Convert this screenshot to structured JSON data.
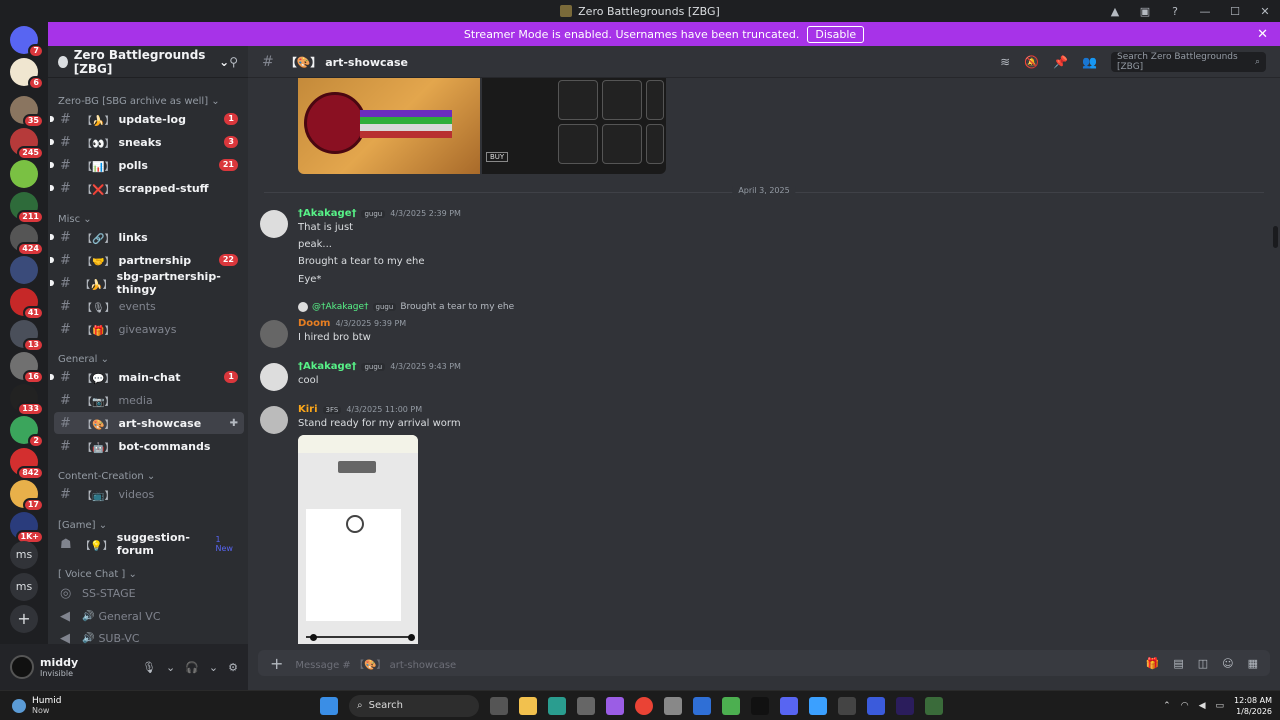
{
  "window": {
    "title": "Zero Battlegrounds [ZBG]",
    "controls": [
      "▲",
      "▣",
      "?",
      "—",
      "☐",
      "✕"
    ]
  },
  "banner": {
    "text": "Streamer Mode is enabled. Usernames have been truncated.",
    "button": "Disable",
    "close": "✕"
  },
  "rail": {
    "badges": [
      "7",
      "6",
      "35",
      "245",
      "211",
      "424",
      "41",
      "13",
      "16",
      "133",
      "2",
      "842",
      "17",
      "1K+"
    ],
    "text_items": [
      "ms",
      "ms"
    ],
    "add": "+"
  },
  "guild": {
    "name": "Zero Battlegrounds [ZBG]",
    "chevron": "⌄"
  },
  "categories": {
    "zero_bg": "Zero-BG [SBG archive as well] ⌄",
    "misc": "Misc ⌄",
    "general": "General ⌄",
    "content": "Content-Creation ⌄",
    "game": "[Game] ⌄",
    "voice": "[ Voice Chat ] ⌄"
  },
  "channels": [
    {
      "emoji": "【🍌】",
      "name": "update-log",
      "count": "1",
      "muted": false
    },
    {
      "emoji": "【👀】",
      "name": "sneaks",
      "count": "3",
      "muted": false
    },
    {
      "emoji": "【📊】",
      "name": "polls",
      "count": "21",
      "muted": false
    },
    {
      "emoji": "【❌】",
      "name": "scrapped-stuff",
      "count": "",
      "muted": false
    },
    {
      "emoji": "【🔗】",
      "name": "links",
      "count": "",
      "muted": false
    },
    {
      "emoji": "【🤝】",
      "name": "partnership",
      "count": "22",
      "muted": false
    },
    {
      "emoji": "【🍌】",
      "name": "sbg-partnership-thingy",
      "count": "",
      "muted": false
    },
    {
      "emoji": "【🎙】",
      "name": "events",
      "count": "",
      "muted": true
    },
    {
      "emoji": "【🎁】",
      "name": "giveaways",
      "count": "",
      "muted": true
    },
    {
      "emoji": "【💬】",
      "name": "main-chat",
      "count": "1",
      "muted": false
    },
    {
      "emoji": "【📷】",
      "name": "media",
      "count": "",
      "muted": true
    },
    {
      "emoji": "【🎨】",
      "name": "art-showcase",
      "count": "",
      "muted": false
    },
    {
      "emoji": "【🤖】",
      "name": "bot-commands",
      "count": "",
      "muted": false
    },
    {
      "emoji": "【📺】",
      "name": "videos",
      "count": "",
      "muted": true
    },
    {
      "emoji": "【💡】",
      "name": "suggestion-forum",
      "count": "1 New",
      "muted": false
    },
    {
      "emoji": "",
      "name": "SS-STAGE",
      "count": "",
      "muted": true
    },
    {
      "emoji": "🔊",
      "name": "General VC",
      "count": "",
      "muted": true
    },
    {
      "emoji": "🔊",
      "name": "SUB-VC",
      "count": "",
      "muted": true
    }
  ],
  "user": {
    "name": "middy",
    "status": "Invisible"
  },
  "header": {
    "channel": "【🎨】 art-showcase",
    "search_placeholder": "Search Zero Battlegrounds [ZBG]"
  },
  "date_divider": "April 3, 2025",
  "img_label": "BUY",
  "messages": [
    {
      "author": "†Akakage†",
      "tag": "gugu",
      "time": "4/3/2025 2:39 PM",
      "lines": [
        "That is just",
        "peak...",
        "Brought a tear to my ehe",
        "Eye*"
      ]
    },
    {
      "reply_author": "@†Akakage†",
      "reply_tag": "gugu",
      "reply_text": "Brought a tear to my ehe",
      "author": "Doom",
      "time": "4/3/2025 9:39 PM",
      "lines": [
        "I hired bro btw"
      ]
    },
    {
      "author": "†Akakage†",
      "tag": "gugu",
      "time": "4/3/2025 9:43 PM",
      "lines": [
        "cool"
      ]
    },
    {
      "author": "Kiri",
      "tag": "3FS",
      "time": "4/3/2025 11:00 PM",
      "lines": [
        "Stand ready for my arrival worm"
      ]
    }
  ],
  "composer": {
    "placeholder": "Message # 【🎨】 art-showcase"
  },
  "taskbar": {
    "weather_title": "Humid",
    "weather_sub": "Now",
    "search": "Search",
    "time": "12:08 AM",
    "date": "1/8/2026"
  },
  "colors": {
    "accent": "#5865f2",
    "banner": "#a733e8",
    "badge": "#da373c",
    "akakage": "#57f287",
    "doom": "#e67e22",
    "kiri": "#faa61a"
  }
}
